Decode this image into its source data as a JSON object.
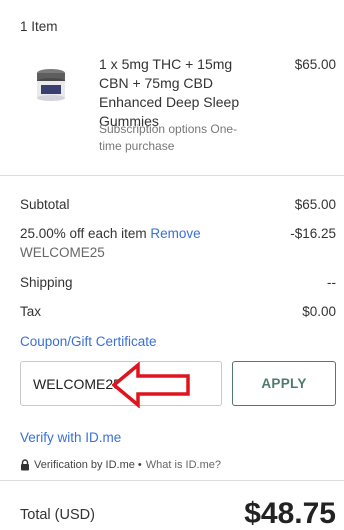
{
  "cart": {
    "items_count": "1 Item"
  },
  "product": {
    "name": "1 x 5mg THC + 15mg CBN + 75mg CBD Enhanced Deep Sleep Gummies",
    "price": "$65.00",
    "subscription": "Subscription options One-time purchase",
    "thumbnail_icon": "product-jar-icon"
  },
  "summary": {
    "subtotal_label": "Subtotal",
    "subtotal_value": "$65.00",
    "discount_label": "25.00% off each item",
    "discount_remove": "Remove",
    "discount_value": "-$16.25",
    "discount_code": "WELCOME25",
    "shipping_label": "Shipping",
    "shipping_value": "--",
    "tax_label": "Tax",
    "tax_value": "$0.00"
  },
  "coupon": {
    "heading": "Coupon/Gift Certificate",
    "value": "WELCOME25",
    "apply_label": "APPLY"
  },
  "idme": {
    "verify_link": "Verify with ID.me",
    "verification_text": "Verification by ID.me •",
    "what_is_link": "What is ID.me?"
  },
  "total": {
    "label": "Total (USD)",
    "value": "$48.75"
  },
  "colors": {
    "link": "#3a6fd8",
    "apply": "#4f7a70",
    "arrow": "#e0141e"
  }
}
